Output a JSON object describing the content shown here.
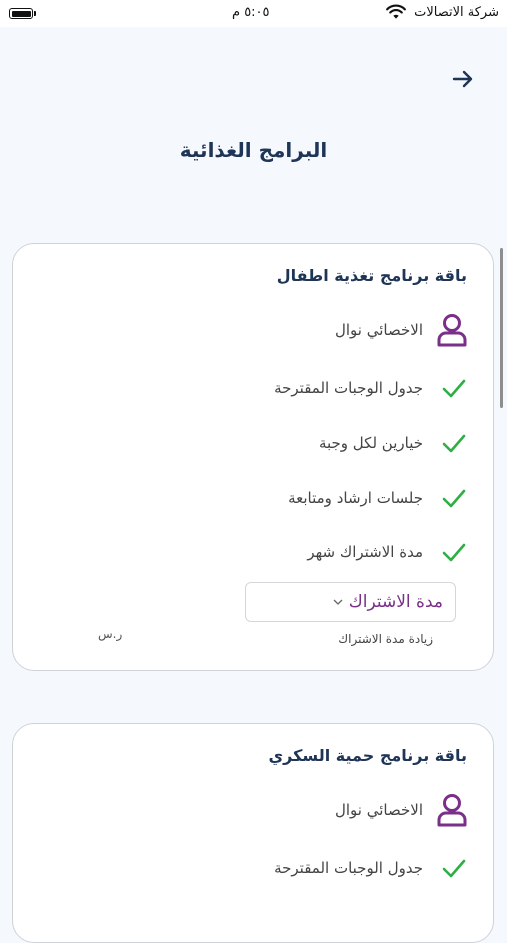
{
  "status_bar": {
    "carrier": "شركة الاتصالات",
    "time": "٥:٠٥ م"
  },
  "header": {
    "title": "البرامج الغذائية",
    "back_icon": "arrow-right-icon"
  },
  "packages": [
    {
      "title": "باقة برنامج تغذية اطفال",
      "specialist": "الاخصائي  نوال",
      "features": [
        "جدول الوجبات المقترحة",
        "خيارين لكل وجبة",
        "جلسات ارشاد ومتابعة",
        "مدة الاشتراك شهر"
      ],
      "select_value": "مدة الاشتراك",
      "increase_label": "زيادة مدة الاشتراك",
      "currency": "ر.س"
    },
    {
      "title": "باقة برنامج حمية السكري",
      "specialist": "الاخصائي نوال",
      "features": [
        "جدول الوجبات المقترحة"
      ]
    }
  ],
  "colors": {
    "primary_dark": "#1f3556",
    "accent_purple": "#7a2f8a",
    "check_green": "#2fae44"
  }
}
